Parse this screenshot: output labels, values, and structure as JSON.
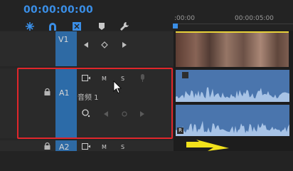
{
  "timeline": {
    "timecode": "00:00:00:00",
    "ruler": {
      "start_label": ":00:00",
      "mid_label": "00:00:05:00"
    }
  },
  "toolbar": {
    "icons": [
      "snap-icon",
      "linked-selection-icon",
      "add-marker-icon",
      "settings-wrench-icon",
      "timeline-display-icon"
    ]
  },
  "tracks": {
    "v1": {
      "label": "V1"
    },
    "a1": {
      "label": "A1",
      "name": "音频 1",
      "mute": "M",
      "solo": "S"
    },
    "a2": {
      "label": "A2",
      "mute": "M",
      "solo": "S"
    }
  },
  "clips": {
    "audio_top_channel": "",
    "audio_bottom_channel": "R"
  },
  "colors": {
    "timecode": "#3a8ee6",
    "target_strip": "#2e6aa4",
    "highlight": "#e0262b",
    "audio_clip": "#4a75ad",
    "video_clip_edge": "#e8d23a",
    "callout_arrow": "#f2e21c"
  }
}
